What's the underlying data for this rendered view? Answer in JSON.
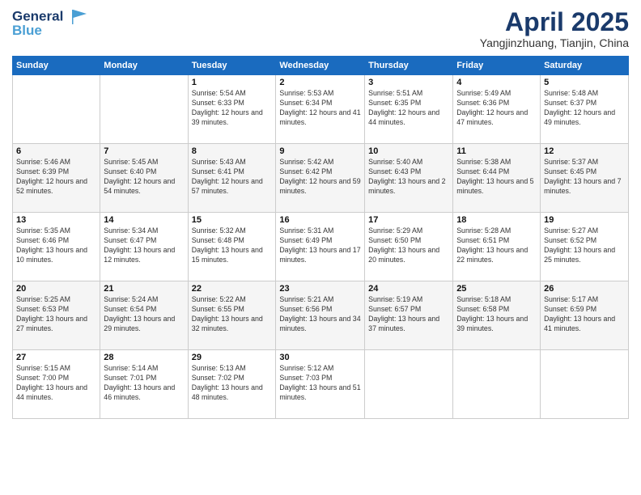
{
  "logo": {
    "line1": "General",
    "line2": "Blue"
  },
  "title": "April 2025",
  "location": "Yangjinzhuang, Tianjin, China",
  "weekdays": [
    "Sunday",
    "Monday",
    "Tuesday",
    "Wednesday",
    "Thursday",
    "Friday",
    "Saturday"
  ],
  "weeks": [
    [
      {
        "day": "",
        "empty": true
      },
      {
        "day": "",
        "empty": true
      },
      {
        "day": "1",
        "sunrise": "Sunrise: 5:54 AM",
        "sunset": "Sunset: 6:33 PM",
        "daylight": "Daylight: 12 hours and 39 minutes."
      },
      {
        "day": "2",
        "sunrise": "Sunrise: 5:53 AM",
        "sunset": "Sunset: 6:34 PM",
        "daylight": "Daylight: 12 hours and 41 minutes."
      },
      {
        "day": "3",
        "sunrise": "Sunrise: 5:51 AM",
        "sunset": "Sunset: 6:35 PM",
        "daylight": "Daylight: 12 hours and 44 minutes."
      },
      {
        "day": "4",
        "sunrise": "Sunrise: 5:49 AM",
        "sunset": "Sunset: 6:36 PM",
        "daylight": "Daylight: 12 hours and 47 minutes."
      },
      {
        "day": "5",
        "sunrise": "Sunrise: 5:48 AM",
        "sunset": "Sunset: 6:37 PM",
        "daylight": "Daylight: 12 hours and 49 minutes."
      }
    ],
    [
      {
        "day": "6",
        "sunrise": "Sunrise: 5:46 AM",
        "sunset": "Sunset: 6:39 PM",
        "daylight": "Daylight: 12 hours and 52 minutes."
      },
      {
        "day": "7",
        "sunrise": "Sunrise: 5:45 AM",
        "sunset": "Sunset: 6:40 PM",
        "daylight": "Daylight: 12 hours and 54 minutes."
      },
      {
        "day": "8",
        "sunrise": "Sunrise: 5:43 AM",
        "sunset": "Sunset: 6:41 PM",
        "daylight": "Daylight: 12 hours and 57 minutes."
      },
      {
        "day": "9",
        "sunrise": "Sunrise: 5:42 AM",
        "sunset": "Sunset: 6:42 PM",
        "daylight": "Daylight: 12 hours and 59 minutes."
      },
      {
        "day": "10",
        "sunrise": "Sunrise: 5:40 AM",
        "sunset": "Sunset: 6:43 PM",
        "daylight": "Daylight: 13 hours and 2 minutes."
      },
      {
        "day": "11",
        "sunrise": "Sunrise: 5:38 AM",
        "sunset": "Sunset: 6:44 PM",
        "daylight": "Daylight: 13 hours and 5 minutes."
      },
      {
        "day": "12",
        "sunrise": "Sunrise: 5:37 AM",
        "sunset": "Sunset: 6:45 PM",
        "daylight": "Daylight: 13 hours and 7 minutes."
      }
    ],
    [
      {
        "day": "13",
        "sunrise": "Sunrise: 5:35 AM",
        "sunset": "Sunset: 6:46 PM",
        "daylight": "Daylight: 13 hours and 10 minutes."
      },
      {
        "day": "14",
        "sunrise": "Sunrise: 5:34 AM",
        "sunset": "Sunset: 6:47 PM",
        "daylight": "Daylight: 13 hours and 12 minutes."
      },
      {
        "day": "15",
        "sunrise": "Sunrise: 5:32 AM",
        "sunset": "Sunset: 6:48 PM",
        "daylight": "Daylight: 13 hours and 15 minutes."
      },
      {
        "day": "16",
        "sunrise": "Sunrise: 5:31 AM",
        "sunset": "Sunset: 6:49 PM",
        "daylight": "Daylight: 13 hours and 17 minutes."
      },
      {
        "day": "17",
        "sunrise": "Sunrise: 5:29 AM",
        "sunset": "Sunset: 6:50 PM",
        "daylight": "Daylight: 13 hours and 20 minutes."
      },
      {
        "day": "18",
        "sunrise": "Sunrise: 5:28 AM",
        "sunset": "Sunset: 6:51 PM",
        "daylight": "Daylight: 13 hours and 22 minutes."
      },
      {
        "day": "19",
        "sunrise": "Sunrise: 5:27 AM",
        "sunset": "Sunset: 6:52 PM",
        "daylight": "Daylight: 13 hours and 25 minutes."
      }
    ],
    [
      {
        "day": "20",
        "sunrise": "Sunrise: 5:25 AM",
        "sunset": "Sunset: 6:53 PM",
        "daylight": "Daylight: 13 hours and 27 minutes."
      },
      {
        "day": "21",
        "sunrise": "Sunrise: 5:24 AM",
        "sunset": "Sunset: 6:54 PM",
        "daylight": "Daylight: 13 hours and 29 minutes."
      },
      {
        "day": "22",
        "sunrise": "Sunrise: 5:22 AM",
        "sunset": "Sunset: 6:55 PM",
        "daylight": "Daylight: 13 hours and 32 minutes."
      },
      {
        "day": "23",
        "sunrise": "Sunrise: 5:21 AM",
        "sunset": "Sunset: 6:56 PM",
        "daylight": "Daylight: 13 hours and 34 minutes."
      },
      {
        "day": "24",
        "sunrise": "Sunrise: 5:19 AM",
        "sunset": "Sunset: 6:57 PM",
        "daylight": "Daylight: 13 hours and 37 minutes."
      },
      {
        "day": "25",
        "sunrise": "Sunrise: 5:18 AM",
        "sunset": "Sunset: 6:58 PM",
        "daylight": "Daylight: 13 hours and 39 minutes."
      },
      {
        "day": "26",
        "sunrise": "Sunrise: 5:17 AM",
        "sunset": "Sunset: 6:59 PM",
        "daylight": "Daylight: 13 hours and 41 minutes."
      }
    ],
    [
      {
        "day": "27",
        "sunrise": "Sunrise: 5:15 AM",
        "sunset": "Sunset: 7:00 PM",
        "daylight": "Daylight: 13 hours and 44 minutes."
      },
      {
        "day": "28",
        "sunrise": "Sunrise: 5:14 AM",
        "sunset": "Sunset: 7:01 PM",
        "daylight": "Daylight: 13 hours and 46 minutes."
      },
      {
        "day": "29",
        "sunrise": "Sunrise: 5:13 AM",
        "sunset": "Sunset: 7:02 PM",
        "daylight": "Daylight: 13 hours and 48 minutes."
      },
      {
        "day": "30",
        "sunrise": "Sunrise: 5:12 AM",
        "sunset": "Sunset: 7:03 PM",
        "daylight": "Daylight: 13 hours and 51 minutes."
      },
      {
        "day": "",
        "empty": true
      },
      {
        "day": "",
        "empty": true
      },
      {
        "day": "",
        "empty": true
      }
    ]
  ]
}
